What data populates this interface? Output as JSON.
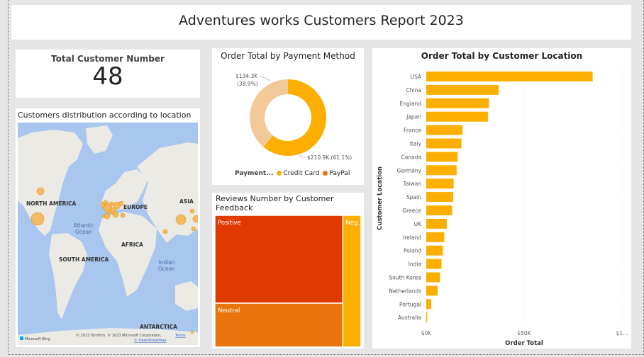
{
  "report": {
    "title": "Adventures works Customers Report 2023"
  },
  "kpi": {
    "label": "Total Customer Number",
    "value": "48"
  },
  "map": {
    "title": "Customers distribution according to location",
    "labels": {
      "north_america": "NORTH AMERICA",
      "europe": "EUROPE",
      "asia": "ASIA",
      "atlantic": "Atlantic",
      "ocean1": "Ocean",
      "africa": "AFRICA",
      "south_america": "SOUTH AMERICA",
      "indian": "Indian",
      "ocean2": "Ocean",
      "antarctica": "ANTARCTICA"
    },
    "attribution_logo": "Microsoft Bing",
    "attribution": "© 2023 TomTom, © 2023 Microsoft Corporation,",
    "terms": "Terms",
    "osm": "© OpenStreetMap",
    "colors": {
      "water": "#a8c6ee",
      "land": "#eceae4",
      "bubble": "#f4b14a"
    }
  },
  "chart_data": [
    {
      "type": "pie",
      "title": "Order Total by Payment Method",
      "legend_title": "Payment...",
      "series": [
        {
          "name": "Credit Card",
          "value": 210.9,
          "label": "$210.9K (61.1%)",
          "color": "#fcaf00"
        },
        {
          "name": "PayPal",
          "value": 134.3,
          "label": "$134.3K",
          "label2": "(38.9%)",
          "color": "#f4c99a"
        }
      ],
      "legend_colors": [
        "#fcaf00",
        "#e8740b"
      ]
    },
    {
      "type": "treemap",
      "title": "Reviews Number by Customer Feedback",
      "items": [
        {
          "name": "Positive",
          "value": 28,
          "color": "#e03a00"
        },
        {
          "name": "Neutral",
          "value": 14,
          "color": "#e8740b"
        },
        {
          "name": "Neg...",
          "value": 6,
          "color": "#fcaf00"
        }
      ]
    },
    {
      "type": "bar",
      "orientation": "horizontal",
      "title": "Order Total by Customer Location",
      "xlabel": "Order Total",
      "ylabel": "Customer Location",
      "color": "#fcaf00",
      "xlim": [
        0,
        100000
      ],
      "x_ticks": [
        "$0K",
        "$50K",
        "$1..."
      ],
      "categories": [
        "USA",
        "China",
        "England",
        "Japan",
        "France",
        "Italy",
        "Canada",
        "Germany",
        "Taiwan",
        "Spain",
        "Greece",
        "UK",
        "Ireland",
        "Poland",
        "India",
        "South Korea",
        "Netherlands",
        "Portugal",
        "Australia"
      ],
      "values": [
        85000,
        37000,
        32000,
        31500,
        18500,
        18000,
        16000,
        15500,
        14000,
        13700,
        13200,
        10500,
        9200,
        8500,
        7800,
        7000,
        5800,
        2500,
        500
      ]
    }
  ]
}
